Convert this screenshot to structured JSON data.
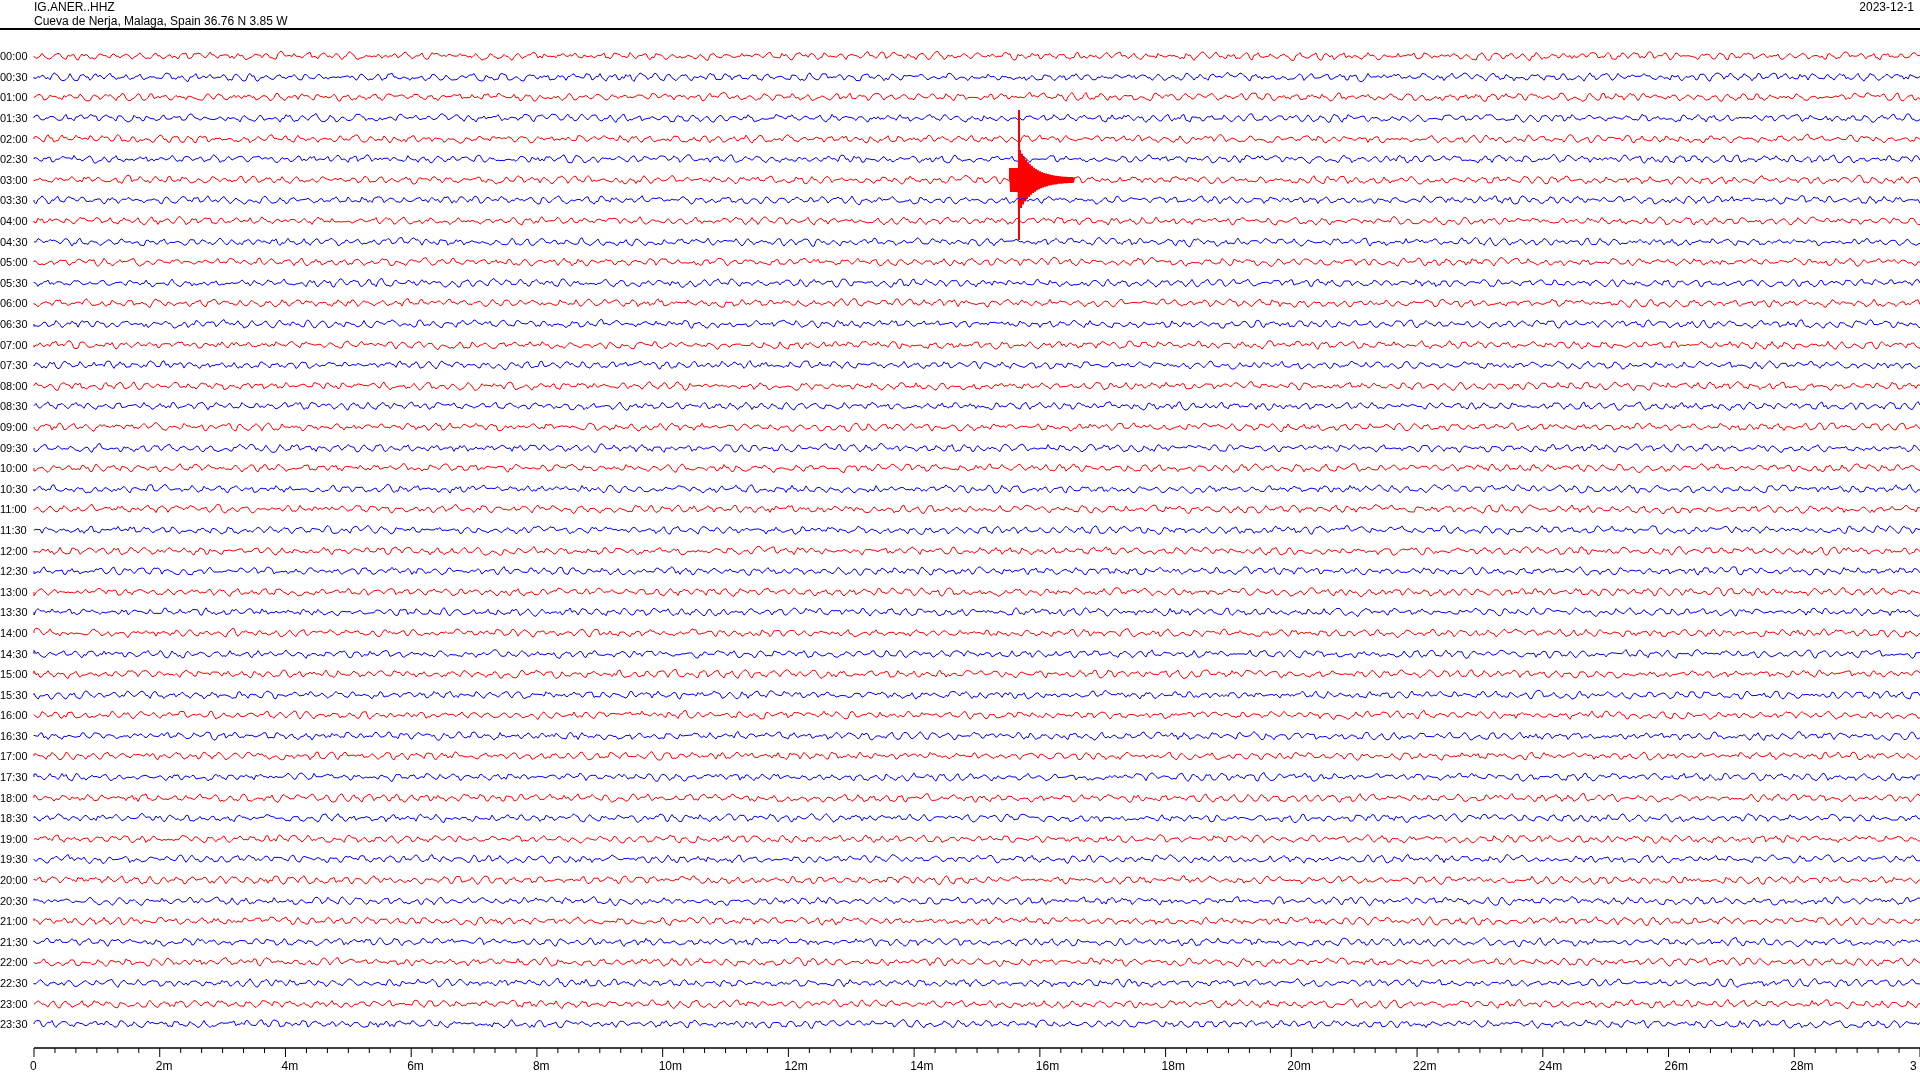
{
  "header": {
    "station": "IG.ANER..HHZ",
    "location": "Cueva de Nerja, Malaga, Spain  36.76 N 3.85 W",
    "date": "2023-12-1"
  },
  "rows": [
    {
      "time": "00:00",
      "color": "#ff0000",
      "kind": "trace"
    },
    {
      "time": "00:30",
      "color": "#0000ff",
      "kind": "trace"
    },
    {
      "time": "01:00",
      "color": "#ff0000",
      "kind": "trace"
    },
    {
      "time": "01:30",
      "color": "#0000ff",
      "kind": "trace"
    },
    {
      "time": "02:00",
      "color": "#ff0000",
      "kind": "trace"
    },
    {
      "time": "02:30",
      "color": "#0000ff",
      "kind": "trace"
    },
    {
      "time": "03:00",
      "color": "#ff0000",
      "kind": "event"
    },
    {
      "time": "03:30",
      "color": "#0000ff",
      "kind": "trace"
    },
    {
      "time": "04:00",
      "color": "#ff0000",
      "kind": "trace"
    },
    {
      "time": "04:30",
      "color": "#0000ff",
      "kind": "trace"
    },
    {
      "time": "05:00",
      "color": "#ff0000",
      "kind": "trace"
    },
    {
      "time": "05:30",
      "color": "#0000ff",
      "kind": "trace"
    },
    {
      "time": "06:00",
      "color": "#ff0000",
      "kind": "trace"
    },
    {
      "time": "06:30",
      "color": "#0000ff",
      "kind": "trace"
    },
    {
      "time": "07:00",
      "color": "#ff0000",
      "kind": "trace"
    },
    {
      "time": "07:30",
      "color": "#0000ff",
      "kind": "trace"
    },
    {
      "time": "08:00",
      "color": "#ff0000",
      "kind": "trace"
    },
    {
      "time": "08:30",
      "color": "#0000ff",
      "kind": "trace"
    },
    {
      "time": "09:00",
      "color": "#ff0000",
      "kind": "trace"
    },
    {
      "time": "09:30",
      "color": "#0000ff",
      "kind": "trace"
    },
    {
      "time": "10:00",
      "color": "#ff0000",
      "kind": "trace"
    },
    {
      "time": "10:30",
      "color": "#0000ff",
      "kind": "trace"
    },
    {
      "time": "11:00",
      "color": "#ff0000",
      "kind": "trace"
    },
    {
      "time": "11:30",
      "color": "#0000ff",
      "kind": "trace"
    },
    {
      "time": "12:00",
      "color": "#ff0000",
      "kind": "trace"
    },
    {
      "time": "12:30",
      "color": "#0000ff",
      "kind": "trace"
    },
    {
      "time": "13:00",
      "color": "#ff0000",
      "kind": "trace"
    },
    {
      "time": "13:30",
      "color": "#0000ff",
      "kind": "trace"
    },
    {
      "time": "14:00",
      "color": "#ff0000",
      "kind": "trace"
    },
    {
      "time": "14:30",
      "color": "#0000ff",
      "kind": "trace"
    },
    {
      "time": "15:00",
      "color": "#ff0000",
      "kind": "trace"
    },
    {
      "time": "15:30",
      "color": "#0000ff",
      "kind": "trace"
    },
    {
      "time": "16:00",
      "color": "#ff0000",
      "kind": "trace"
    },
    {
      "time": "16:30",
      "color": "#0000ff",
      "kind": "trace"
    },
    {
      "time": "17:00",
      "color": "#ff0000",
      "kind": "trace"
    },
    {
      "time": "17:30",
      "color": "#0000ff",
      "kind": "trace"
    },
    {
      "time": "18:00",
      "color": "#ff0000",
      "kind": "trace"
    },
    {
      "time": "18:30",
      "color": "#0000ff",
      "kind": "trace"
    },
    {
      "time": "19:00",
      "color": "#ff0000",
      "kind": "trace"
    },
    {
      "time": "19:30",
      "color": "#0000ff",
      "kind": "trace"
    },
    {
      "time": "20:00",
      "color": "#ff0000",
      "kind": "trace"
    },
    {
      "time": "20:30",
      "color": "#0000ff",
      "kind": "trace"
    },
    {
      "time": "21:00",
      "color": "#ff0000",
      "kind": "trace"
    },
    {
      "time": "21:30",
      "color": "#0000ff",
      "kind": "trace"
    },
    {
      "time": "22:00",
      "color": "#ff0000",
      "kind": "trace"
    },
    {
      "time": "22:30",
      "color": "#0000ff",
      "kind": "trace"
    },
    {
      "time": "23:00",
      "color": "#ff0000",
      "kind": "trace"
    },
    {
      "time": "23:30",
      "color": "#0000ff",
      "kind": "trace"
    }
  ],
  "axis_labels": [
    "0",
    "2m",
    "4m",
    "6m",
    "8m",
    "10m",
    "12m",
    "14m",
    "16m",
    "18m",
    "20m",
    "22m",
    "24m",
    "26m",
    "28m",
    "3"
  ]
}
